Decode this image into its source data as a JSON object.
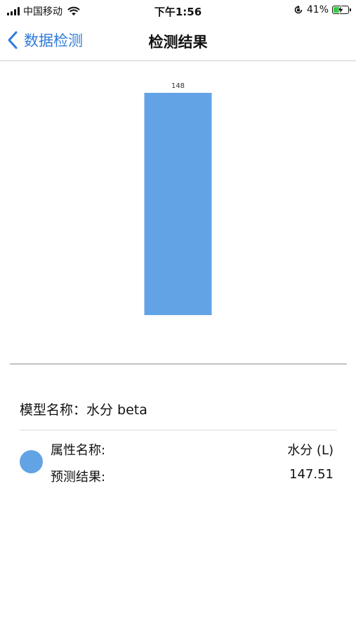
{
  "status_bar": {
    "carrier": "中国移动",
    "time": "下午1:56",
    "battery_percent": "41%",
    "battery_level": 0.41,
    "icons": [
      "signal-icon",
      "wifi-icon",
      "rotation-lock-icon",
      "battery-charging-icon"
    ]
  },
  "nav": {
    "back_label": "数据检测",
    "title": "检测结果",
    "back_icon": "chevron-left-icon"
  },
  "chart_data": {
    "type": "bar",
    "categories": [
      ""
    ],
    "values": [
      148
    ],
    "data_labels": [
      "148"
    ],
    "ylim": [
      0,
      148
    ],
    "grid": false,
    "legend": "none",
    "bar_color": "#62a3e5"
  },
  "info": {
    "model_label": "模型名称：",
    "model_value": "水分 beta",
    "property_label": "属性名称:",
    "property_value": "水分 (L)",
    "result_label": "预测结果:",
    "result_value": "147.51",
    "legend_color": "#62a3e5"
  },
  "colors": {
    "accent": "#2f7bd8",
    "bar": "#62a3e5"
  }
}
